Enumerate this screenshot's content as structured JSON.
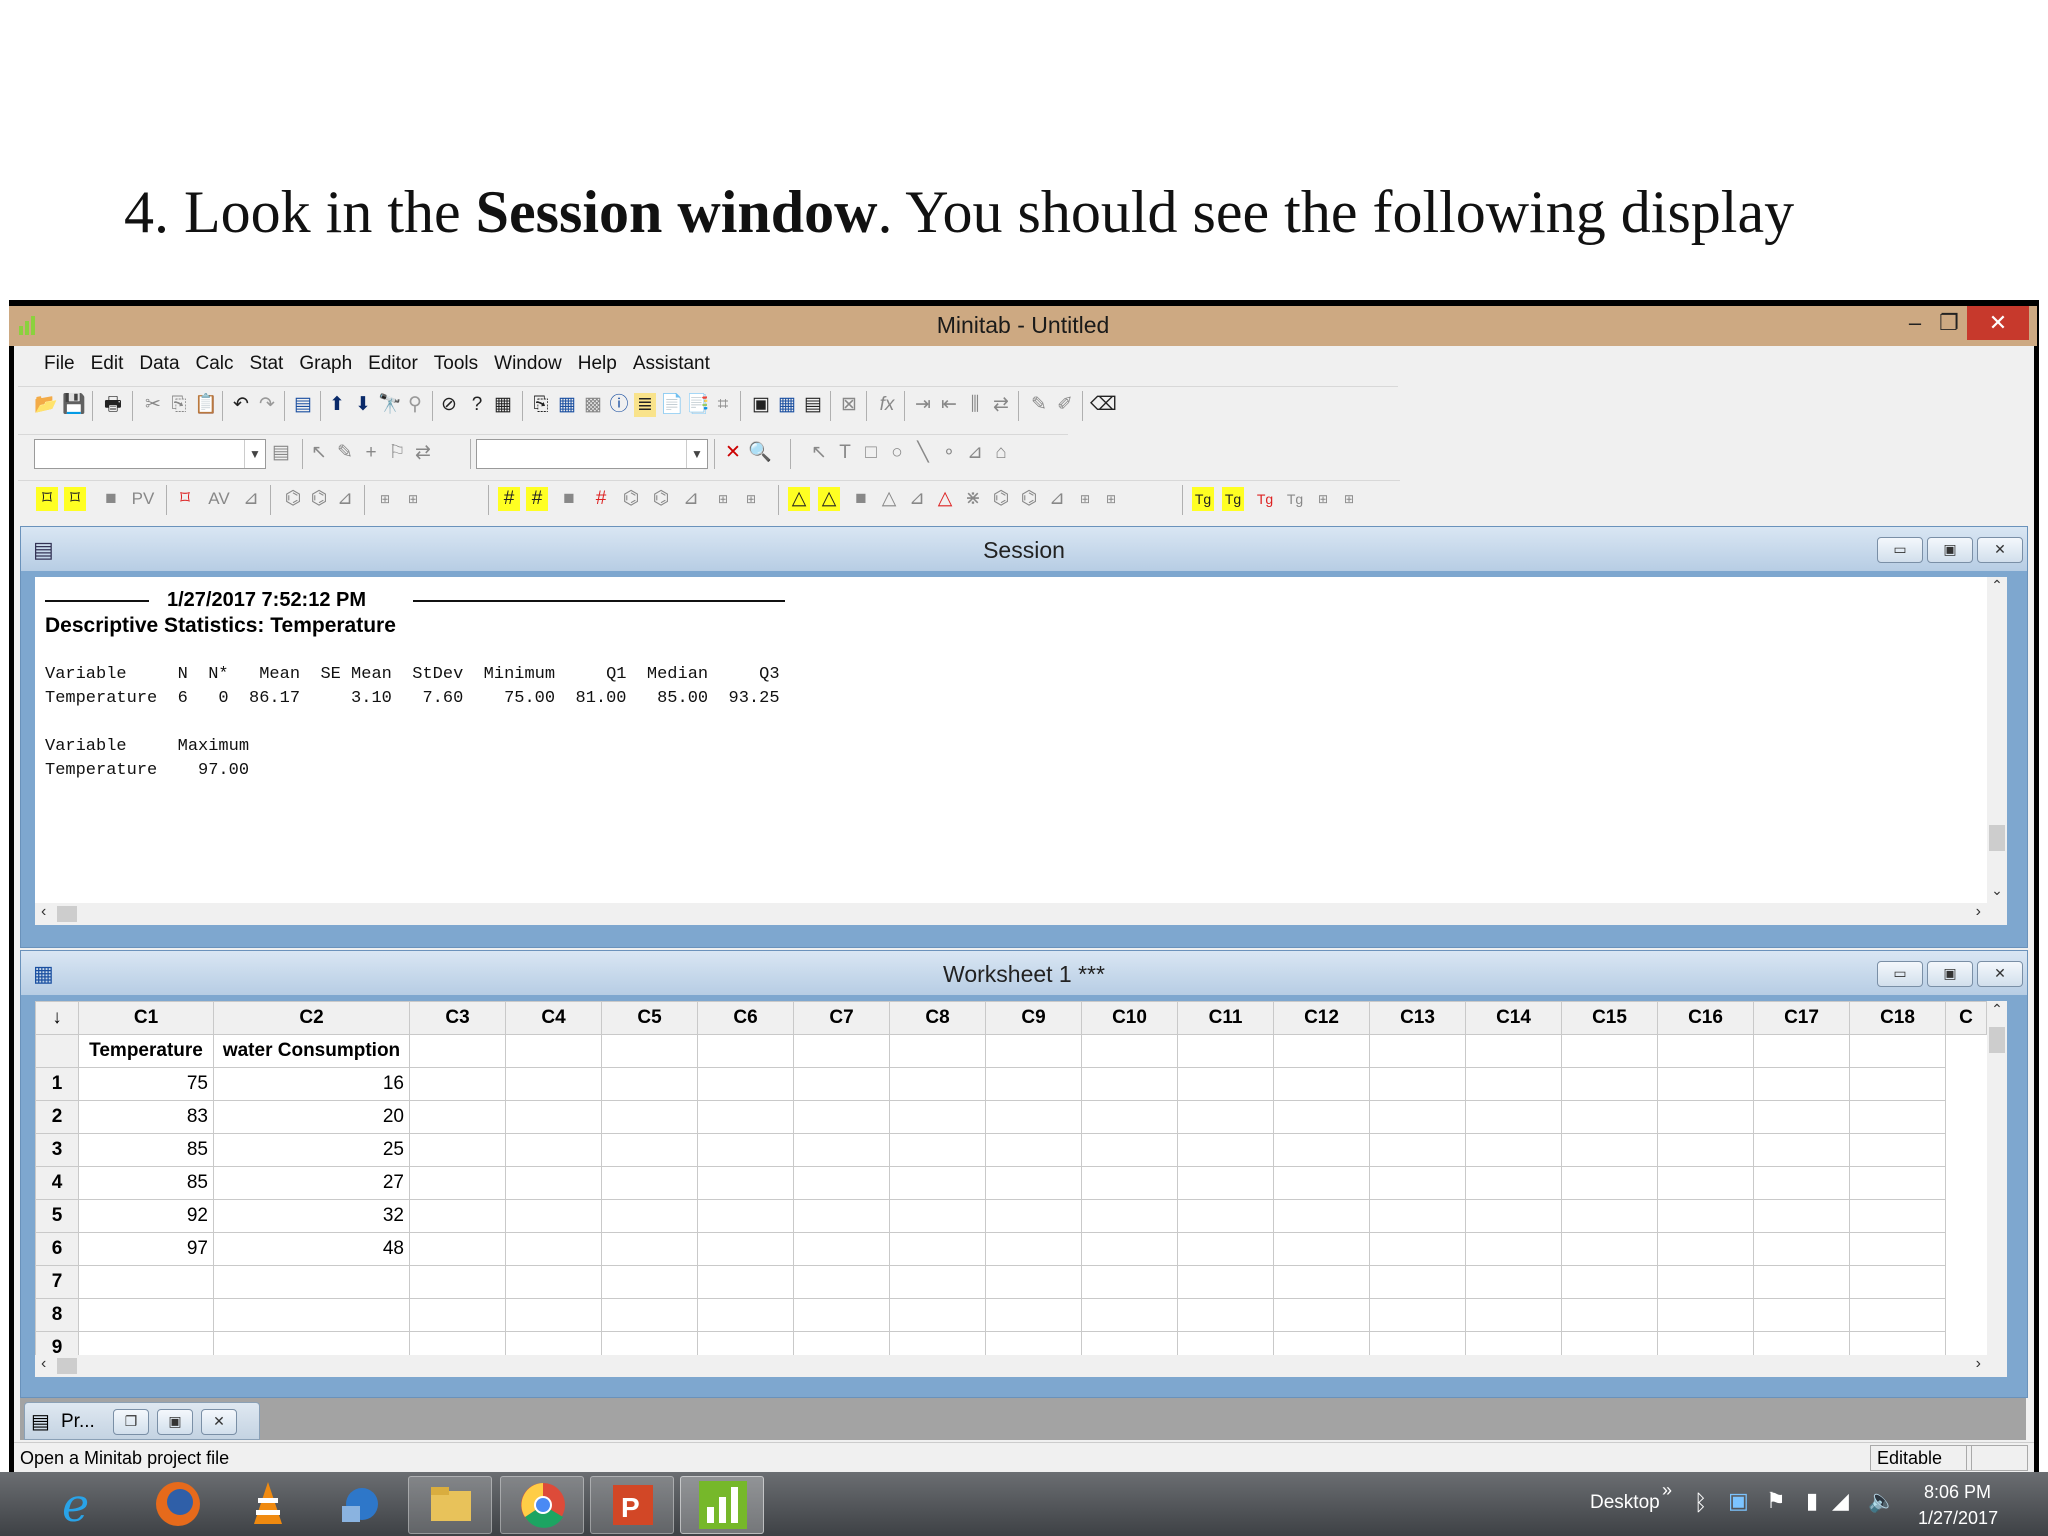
{
  "slide": {
    "title_prefix": "4. Look in the ",
    "title_bold": "Session window",
    "title_suffix": ". You should see the following display"
  },
  "window": {
    "title": "Minitab - Untitled",
    "minimize": "‒",
    "restore": "❐",
    "close": "✕"
  },
  "menu": [
    "File",
    "Edit",
    "Data",
    "Calc",
    "Stat",
    "Graph",
    "Editor",
    "Tools",
    "Window",
    "Help",
    "Assistant"
  ],
  "toolbar3": {
    "pv_label": "PV",
    "av_label": "AV"
  },
  "session": {
    "title": "Session",
    "timestamp": "1/27/2017 7:52:12 PM",
    "heading": "Descriptive Statistics: Temperature",
    "line1": "Variable     N  N*   Mean  SE Mean  StDev  Minimum     Q1  Median     Q3",
    "line2": "Temperature  6   0  86.17     3.10   7.60    75.00  81.00   85.00  93.25",
    "line3": "Variable     Maximum",
    "line4": "Temperature    97.00"
  },
  "worksheet": {
    "title": "Worksheet 1 ***",
    "corner": "↓",
    "columns": [
      "C1",
      "C2",
      "C3",
      "C4",
      "C5",
      "C6",
      "C7",
      "C8",
      "C9",
      "C10",
      "C11",
      "C12",
      "C13",
      "C14",
      "C15",
      "C16",
      "C17",
      "C18",
      "C"
    ],
    "names": [
      "Temperature",
      "water Consumption"
    ],
    "rows": [
      {
        "n": "1",
        "c1": "75",
        "c2": "16"
      },
      {
        "n": "2",
        "c1": "83",
        "c2": "20"
      },
      {
        "n": "3",
        "c1": "85",
        "c2": "25"
      },
      {
        "n": "4",
        "c1": "85",
        "c2": "27"
      },
      {
        "n": "5",
        "c1": "92",
        "c2": "32"
      },
      {
        "n": "6",
        "c1": "97",
        "c2": "48"
      },
      {
        "n": "7",
        "c1": "",
        "c2": ""
      },
      {
        "n": "8",
        "c1": "",
        "c2": ""
      },
      {
        "n": "9",
        "c1": "",
        "c2": ""
      }
    ]
  },
  "minimized_project": {
    "label": "Pr..."
  },
  "status": {
    "text": "Open a Minitab project file",
    "mode": "Editable"
  },
  "taskbar": {
    "desktop_label": "Desktop",
    "chevron": "»",
    "time": "8:06 PM",
    "date": "1/27/2017"
  }
}
